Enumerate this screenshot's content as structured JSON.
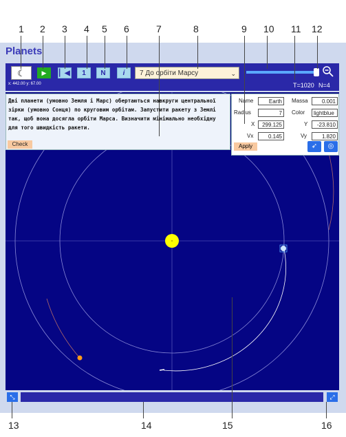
{
  "callouts": [
    "1",
    "2",
    "3",
    "4",
    "5",
    "6",
    "7",
    "8",
    "9",
    "10",
    "11",
    "12",
    "13",
    "14",
    "15",
    "16"
  ],
  "app": {
    "title": "Planets"
  },
  "toolbar": {
    "moon_icon": "moon-stars-icon",
    "play_icon": "play-icon",
    "back_label": "▏◀",
    "one_label": "1",
    "n_label": "N",
    "info_label": "i",
    "coords": "x: 442.00 y: 67.00",
    "scenario_selected": "7 До орбіти Марсу",
    "time": "T=1020",
    "n": "N=4",
    "zoom_icon": "zoom-out-icon"
  },
  "task": {
    "text": "Дві планети (умовно Земля і Марс) обертаються навкруги центральної зірки (умовно Сонця) по круговим орбітам. Запустити ракету з Землі так, щоб вона досягла орбіти Марса. Визначити мінімально необхідну для того швидкість ракети.",
    "check_label": "Check"
  },
  "properties": {
    "name_label": "Name",
    "name_value": "Earth",
    "massa_label": "Massa",
    "massa_value": "0.001",
    "radius_label": "Radius",
    "radius_value": "7",
    "color_label": "Color",
    "color_value": "lightblue",
    "x_label": "X",
    "x_value": "299.125",
    "y_label": "Y",
    "y_value": "-23.810",
    "vx_label": "Vx",
    "vx_value": "0.145",
    "vy_label": "Vy",
    "vy_value": "1.820",
    "apply_label": "Apply",
    "rocket_icon": "rocket-icon",
    "target_icon": "target-icon"
  },
  "colors": {
    "space": "#050584",
    "sun": "#ffff00",
    "earth": "#cce6ff",
    "mars": "#ff9a1a",
    "toolbar": "#2a28a8"
  },
  "status": {
    "left_icon": "expand-icon",
    "right_icon": "collapse-icon"
  }
}
